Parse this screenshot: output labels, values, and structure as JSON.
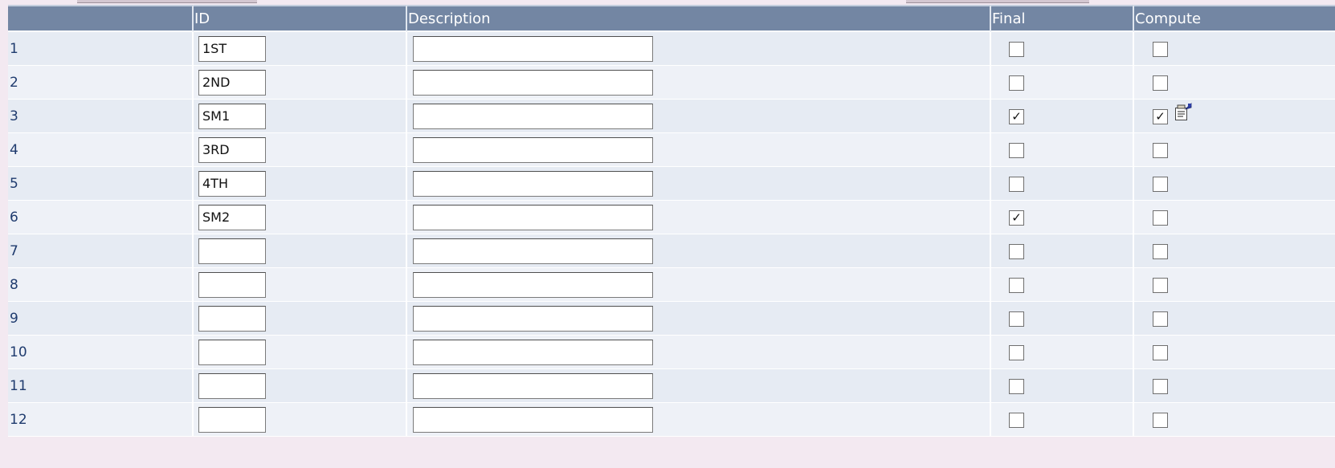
{
  "columns": {
    "row": "",
    "id": "ID",
    "description": "Description",
    "final": "Final",
    "compute": "Compute"
  },
  "rows": [
    {
      "num": "1",
      "id": "1ST",
      "description": "",
      "final": false,
      "compute": false,
      "compute_icon": false
    },
    {
      "num": "2",
      "id": "2ND",
      "description": "",
      "final": false,
      "compute": false,
      "compute_icon": false
    },
    {
      "num": "3",
      "id": "SM1",
      "description": "",
      "final": true,
      "compute": true,
      "compute_icon": true
    },
    {
      "num": "4",
      "id": "3RD",
      "description": "",
      "final": false,
      "compute": false,
      "compute_icon": false
    },
    {
      "num": "5",
      "id": "4TH",
      "description": "",
      "final": false,
      "compute": false,
      "compute_icon": false
    },
    {
      "num": "6",
      "id": "SM2",
      "description": "",
      "final": true,
      "compute": false,
      "compute_icon": false
    },
    {
      "num": "7",
      "id": "",
      "description": "",
      "final": false,
      "compute": false,
      "compute_icon": false
    },
    {
      "num": "8",
      "id": "",
      "description": "",
      "final": false,
      "compute": false,
      "compute_icon": false
    },
    {
      "num": "9",
      "id": "",
      "description": "",
      "final": false,
      "compute": false,
      "compute_icon": false
    },
    {
      "num": "10",
      "id": "",
      "description": "",
      "final": false,
      "compute": false,
      "compute_icon": false
    },
    {
      "num": "11",
      "id": "",
      "description": "",
      "final": false,
      "compute": false,
      "compute_icon": false
    },
    {
      "num": "12",
      "id": "",
      "description": "",
      "final": false,
      "compute": false,
      "compute_icon": false
    }
  ],
  "icons": {
    "compute_details": "properties-sheet-icon",
    "check_mark": "✓"
  },
  "colors": {
    "header_bg": "#7386a3",
    "row_odd": "#e6ebf3",
    "row_even": "#eef1f7",
    "row_number": "#1f3b6e"
  }
}
